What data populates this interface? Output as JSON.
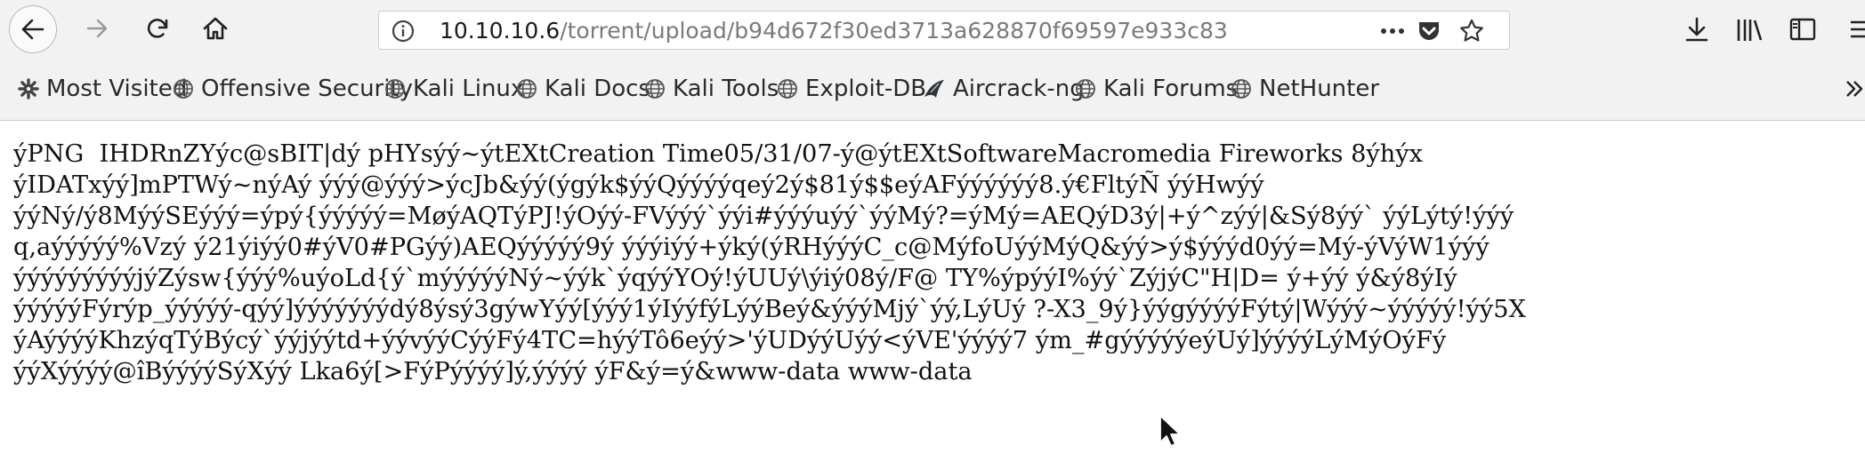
{
  "toolbar": {
    "url_host": "10.10.10.6",
    "url_path": "/torrent/upload/b94d672f30ed3713a628870f69597e933c83",
    "back_icon": "back-arrow-icon",
    "forward_icon": "forward-arrow-icon",
    "reload_icon": "reload-icon",
    "home_icon": "home-icon",
    "info_icon": "info-icon",
    "more_icon": "more-horizontal-icon",
    "pocket_icon": "pocket-icon",
    "bookmark_star_icon": "star-icon",
    "downloads_icon": "download-icon",
    "library_icon": "library-icon",
    "sidebar_icon": "sidebar-icon",
    "menu_icon": "hamburger-menu-icon"
  },
  "bookmarks": [
    {
      "label": "Most Visited",
      "icon": "gear-icon"
    },
    {
      "label": "Offensive Security",
      "icon": "globe-icon"
    },
    {
      "label": "Kali Linux",
      "icon": "globe-icon"
    },
    {
      "label": "Kali Docs",
      "icon": "globe-icon"
    },
    {
      "label": "Kali Tools",
      "icon": "globe-icon"
    },
    {
      "label": "Exploit-DB",
      "icon": "globe-icon"
    },
    {
      "label": "Aircrack-ng",
      "icon": "aircrack-icon"
    },
    {
      "label": "Kali Forums",
      "icon": "globe-icon"
    },
    {
      "label": "NetHunter",
      "icon": "globe-icon"
    }
  ],
  "bookmarks_overflow_icon": "chevron-double-right-icon",
  "content": {
    "lines": [
      "ýPNG  IHDRnZYýc@sBIT|dý pHYsýý~ýtEXtCreation Time05/31/07-ý@ýtEXtSoftwareMacromedia Fireworks 8ýhýx",
      "ýIDATxýý]mPTWý~nýAý ýýý@ýýý>ýcJb&ýý(ýgýk$ýýQýýýýqeý2ý$81ý$$eýAFýýýýýý8.ý€FltýÑ ýýHwýý",
      "ýýNý/ý8MýýSEýýý=ýpý{ýýýýý=MøýAQTýPJ!ýOýý-FVýýý`ýýi#ýýýuýý`ýýMý?=ýMý=AEQýD3ý|+ý^zýý|&Sý8ýý` ýýLýtý!ýýý",
      "q,aýýýýý%Vzý ý21ýiýý0#ýV0#PGýý)AEQýýýýý9ý ýýýiýý+ýký(ýRHýýýC_c@MýfoUýýMýQ&ýý>ý$ýýýd0ýý=Mý-ýVýW1ýýý",
      "ýýýýýýýýýjýZýsw{ýýý%uýoLd{ý`mýýýýýNý~ýýk`ýqýýYOý!ýUUý\\ýiý08ý/F@ TY%ýpýýI%ýý`ZýjýC\"H|D= ý+ýý ý&ý8ýIý",
      "ýýýýýFýrýp_ýýýýý-qýý]ýýýýýýýdý8ýsý3gýwYýý[ýýý1ýIýýfýLýýBeý&ýýýMjý`ýý,LýUý ?-X3_9ý}ýýgýýýýFýtý|Wýýý~ýýýýý!ýý5X",
      "ýAýýýýKhzýqTýBýcý`ýýjýýtd+ýývýýCýýFý4TC=hýýTô6eýý>'ýUDýýUýý<ýVE'ýýýý7 ým_#gýýýýýeýUý]ýýýýLýMýOýFý",
      "ýýXýýýý@îBýýýýSýXýý Lka6ý[>FýPýýýý]ý,ýýýý ýF&ý=ý&www-data www-data"
    ]
  }
}
